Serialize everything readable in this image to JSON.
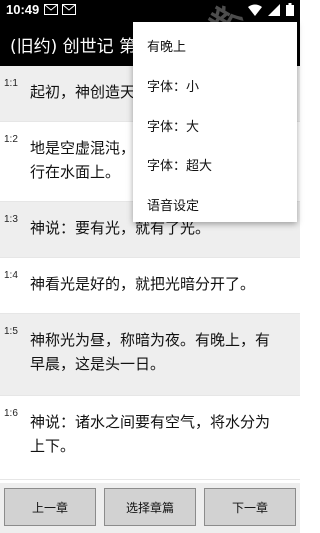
{
  "status": {
    "time": "10:49"
  },
  "header": {
    "title": "(旧约) 创世记 第一章"
  },
  "menu": {
    "items": [
      "有晚上",
      "字体：小",
      "字体：大",
      "字体：超大",
      "语音设定"
    ]
  },
  "verses": [
    {
      "num": "1:1",
      "text": "起初，神创造天地。"
    },
    {
      "num": "1:2",
      "text": "地是空虚混沌，渊面黑暗；神的灵运行在水面上。"
    },
    {
      "num": "1:3",
      "text": "神说：要有光，就有了光。"
    },
    {
      "num": "1:4",
      "text": "神看光是好的，就把光暗分开了。"
    },
    {
      "num": "1:5",
      "text": "神称光为昼，称暗为夜。有晚上，有早晨，这是头一日。"
    },
    {
      "num": "1:6",
      "text": "神说：诸水之间要有空气，将水分为上下。"
    }
  ],
  "footer": {
    "prev": "上一章",
    "select": "选择章篇",
    "next": "下一章"
  },
  "colors": {
    "bar": "#000000",
    "zebra": "#eeeeee",
    "button": "#d2d2d2"
  },
  "icons": [
    "gmail-icon",
    "mail-icon",
    "wifi-icon",
    "cell-signal-icon",
    "battery-icon"
  ]
}
